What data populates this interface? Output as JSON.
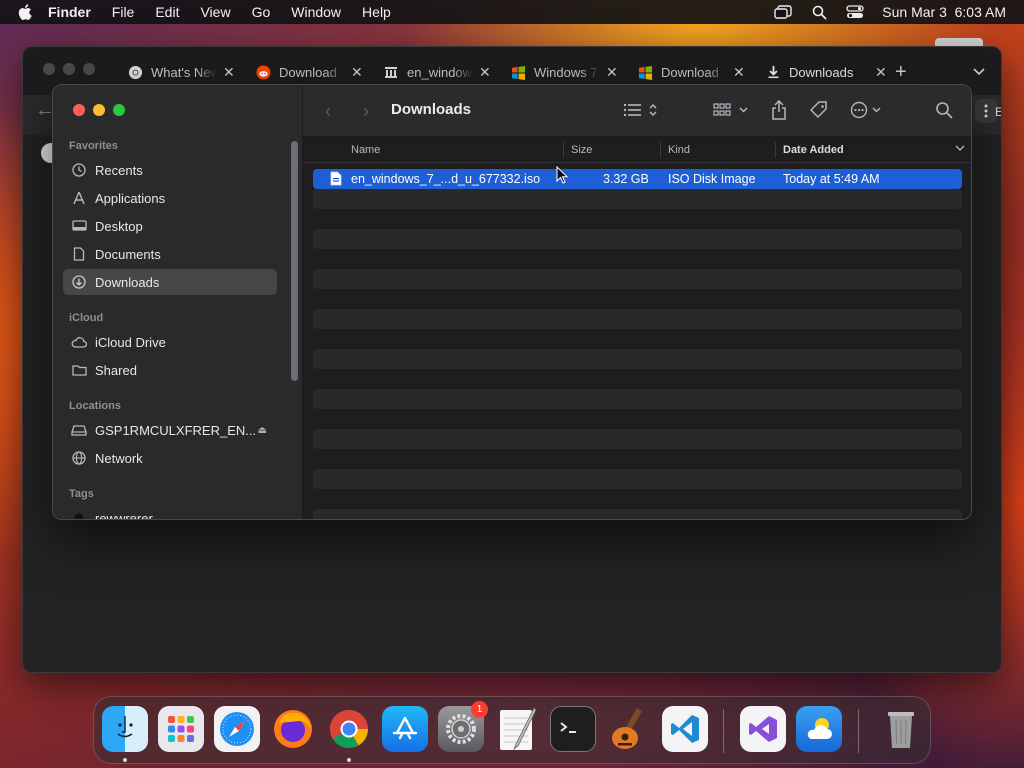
{
  "menubar": {
    "app_name": "Finder",
    "items": [
      "File",
      "Edit",
      "View",
      "Go",
      "Window",
      "Help"
    ],
    "datetime": "Sun Mar 3  6:03 AM"
  },
  "browser": {
    "tabs": [
      {
        "label": "What's New",
        "icon": "chrome-icon"
      },
      {
        "label": "Download",
        "icon": "reddit-icon"
      },
      {
        "label": "en_windows",
        "icon": "archive-icon"
      },
      {
        "label": "Windows 7",
        "icon": "windows-icon"
      },
      {
        "label": "Download",
        "icon": "windows-icon"
      },
      {
        "label": "Downloads",
        "icon": "download-icon"
      }
    ],
    "right_cut_text": "E"
  },
  "finder": {
    "title": "Downloads",
    "sidebar": {
      "favorites_header": "Favorites",
      "favorites": [
        {
          "label": "Recents",
          "icon": "clock-icon"
        },
        {
          "label": "Applications",
          "icon": "applications-icon"
        },
        {
          "label": "Desktop",
          "icon": "desktop-icon"
        },
        {
          "label": "Documents",
          "icon": "document-icon"
        },
        {
          "label": "Downloads",
          "icon": "download-circle-icon",
          "selected": true
        }
      ],
      "icloud_header": "iCloud",
      "icloud": [
        {
          "label": "iCloud Drive",
          "icon": "cloud-icon"
        },
        {
          "label": "Shared",
          "icon": "shared-folder-icon"
        }
      ],
      "locations_header": "Locations",
      "locations": [
        {
          "label": "GSP1RMCULXFRER_EN...",
          "icon": "drive-icon"
        },
        {
          "label": "Network",
          "icon": "network-icon"
        }
      ],
      "tags_header": "Tags",
      "tags": [
        {
          "label": "rewwrerer"
        }
      ]
    },
    "columns": {
      "name": "Name",
      "size": "Size",
      "kind": "Kind",
      "date_added": "Date Added"
    },
    "files": [
      {
        "name": "en_windows_7_...d_u_677332.iso",
        "size": "3.32 GB",
        "kind": "ISO Disk Image",
        "date_added": "Today at 5:49 AM",
        "selected": true
      }
    ]
  },
  "dock": {
    "apps": [
      "Finder",
      "Launchpad",
      "Safari",
      "Firefox",
      "Google Chrome",
      "App Store",
      "System Settings",
      "TextEdit",
      "Terminal",
      "GarageBand",
      "Visual Studio Code",
      "Visual Studio",
      "Weather",
      "Trash"
    ],
    "settings_badge": "1"
  },
  "colors": {
    "selection": "#1f5fd6",
    "sidebar_selected": "#464649",
    "close": "#ff5f57",
    "minimize": "#febc2e",
    "zoom": "#28c840"
  }
}
